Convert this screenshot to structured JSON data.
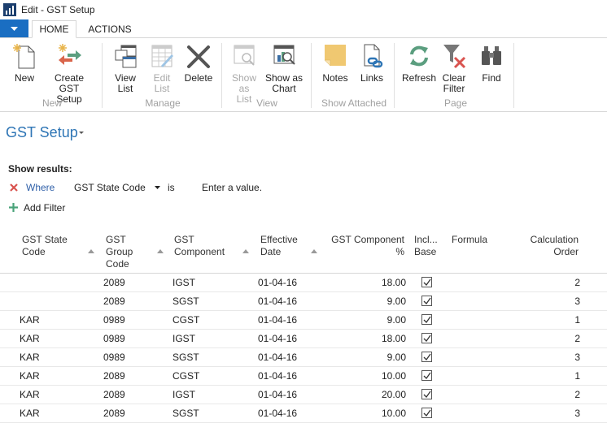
{
  "window": {
    "title": "Edit - GST Setup"
  },
  "tabs": [
    {
      "label": "HOME",
      "active": true
    },
    {
      "label": "ACTIONS",
      "active": false
    }
  ],
  "ribbon": {
    "groups": [
      {
        "label": "New",
        "buttons": [
          {
            "label1": "New",
            "label2": "",
            "icon": "new-document-icon",
            "enabled": true
          },
          {
            "label1": "Create GST",
            "label2": "Setup",
            "icon": "create-arrows-icon",
            "enabled": true
          }
        ]
      },
      {
        "label": "Manage",
        "buttons": [
          {
            "label1": "View",
            "label2": "List",
            "icon": "view-list-icon",
            "enabled": true
          },
          {
            "label1": "Edit",
            "label2": "List",
            "icon": "edit-list-icon",
            "enabled": false
          },
          {
            "label1": "Delete",
            "label2": "",
            "icon": "delete-x-icon",
            "enabled": true
          }
        ]
      },
      {
        "label": "View",
        "buttons": [
          {
            "label1": "Show",
            "label2": "as List",
            "icon": "show-list-icon",
            "enabled": false
          },
          {
            "label1": "Show as",
            "label2": "Chart",
            "icon": "show-chart-icon",
            "enabled": true
          }
        ]
      },
      {
        "label": "Show Attached",
        "buttons": [
          {
            "label1": "Notes",
            "label2": "",
            "icon": "notes-icon",
            "enabled": true
          },
          {
            "label1": "Links",
            "label2": "",
            "icon": "links-icon",
            "enabled": true
          }
        ]
      },
      {
        "label": "Page",
        "buttons": [
          {
            "label1": "Refresh",
            "label2": "",
            "icon": "refresh-icon",
            "enabled": true
          },
          {
            "label1": "Clear",
            "label2": "Filter",
            "icon": "clear-filter-icon",
            "enabled": true
          },
          {
            "label1": "Find",
            "label2": "",
            "icon": "binoculars-icon",
            "enabled": true
          }
        ]
      }
    ]
  },
  "page": {
    "title": "GST Setup"
  },
  "filter": {
    "show_results": "Show results:",
    "where": "Where",
    "field": "GST State Code",
    "operator": "is",
    "value_placeholder": "Enter a value.",
    "add_filter": "Add Filter"
  },
  "table": {
    "headers": {
      "state": [
        "GST State",
        "Code"
      ],
      "group": [
        "GST",
        "Group",
        "Code"
      ],
      "component": [
        "GST",
        "Component"
      ],
      "date": [
        "Effective",
        "Date"
      ],
      "pct": [
        "GST Component",
        "%"
      ],
      "incl": [
        "Incl...",
        "Base"
      ],
      "formula": [
        "Formula"
      ],
      "order": [
        "Calculation",
        "Order"
      ]
    },
    "rows": [
      {
        "state": "",
        "group": "2089",
        "component": "IGST",
        "date": "01-04-16",
        "pct": "18.00",
        "incl": true,
        "formula": "",
        "order": "2"
      },
      {
        "state": "",
        "group": "2089",
        "component": "SGST",
        "date": "01-04-16",
        "pct": "9.00",
        "incl": true,
        "formula": "",
        "order": "3"
      },
      {
        "state": "KAR",
        "group": "0989",
        "component": "CGST",
        "date": "01-04-16",
        "pct": "9.00",
        "incl": true,
        "formula": "",
        "order": "1"
      },
      {
        "state": "KAR",
        "group": "0989",
        "component": "IGST",
        "date": "01-04-16",
        "pct": "18.00",
        "incl": true,
        "formula": "",
        "order": "2"
      },
      {
        "state": "KAR",
        "group": "0989",
        "component": "SGST",
        "date": "01-04-16",
        "pct": "9.00",
        "incl": true,
        "formula": "",
        "order": "3"
      },
      {
        "state": "KAR",
        "group": "2089",
        "component": "CGST",
        "date": "01-04-16",
        "pct": "10.00",
        "incl": true,
        "formula": "",
        "order": "1"
      },
      {
        "state": "KAR",
        "group": "2089",
        "component": "IGST",
        "date": "01-04-16",
        "pct": "20.00",
        "incl": true,
        "formula": "",
        "order": "2"
      },
      {
        "state": "KAR",
        "group": "2089",
        "component": "SGST",
        "date": "01-04-16",
        "pct": "10.00",
        "incl": true,
        "formula": "",
        "order": "3"
      }
    ]
  },
  "colors": {
    "accent": "#1a6ec2",
    "title": "#2e75b5",
    "delete": "#d9534f",
    "add": "#4aa37a"
  }
}
